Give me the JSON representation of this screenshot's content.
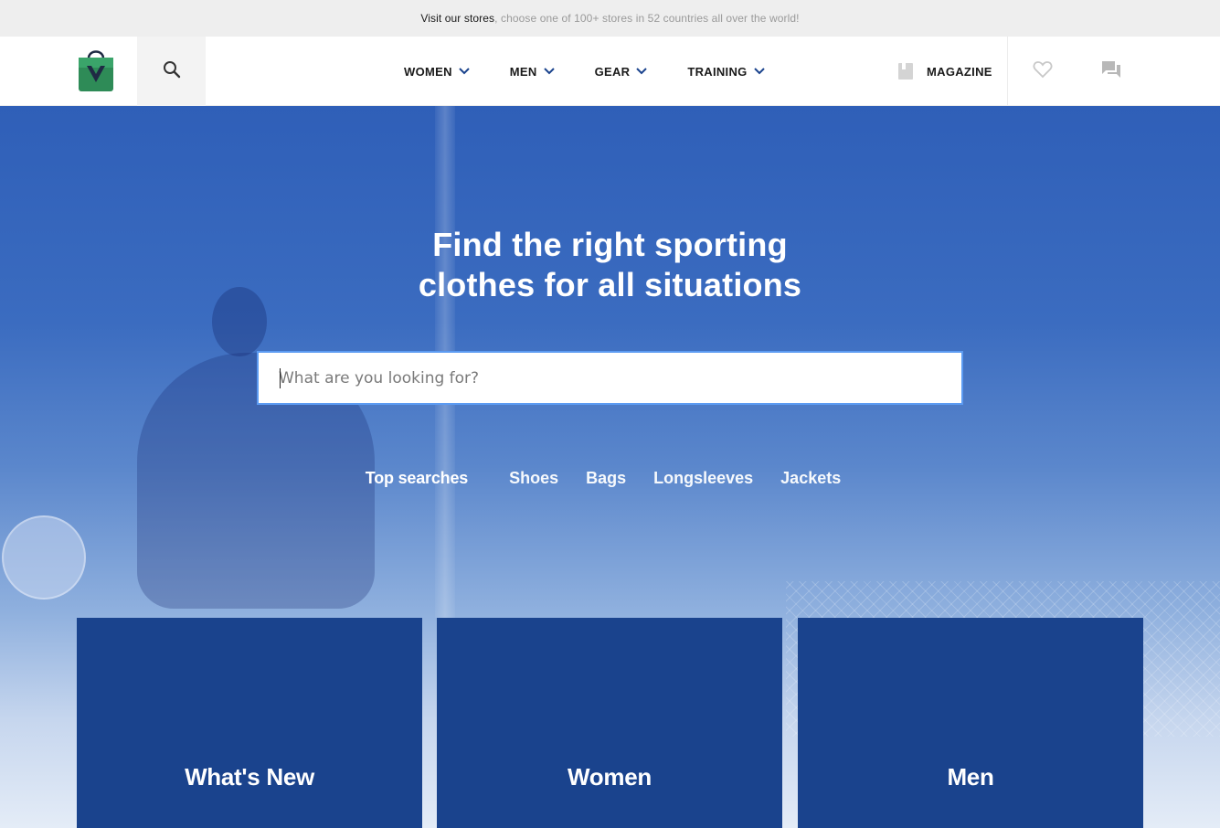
{
  "topbar": {
    "lead": "Visit our stores",
    "rest": ", choose one of 100+ stores in 52 countries all over the world!"
  },
  "header": {
    "logo_icon": "shopping-bag-logo",
    "search_icon": "search-icon",
    "nav": [
      {
        "label": "WOMEN"
      },
      {
        "label": "MEN"
      },
      {
        "label": "GEAR"
      },
      {
        "label": "TRAINING"
      }
    ],
    "magazine_label": "MAGAZINE",
    "wishlist_icon": "heart-icon",
    "chat_icon": "chat-icon"
  },
  "hero": {
    "title_line1": "Find the right sporting",
    "title_line2": "clothes for all situations",
    "search_placeholder": "What are you looking for?",
    "search_value": "",
    "top_searches_label": "Top searches",
    "top_searches": [
      "Shoes",
      "Bags",
      "Longsleeves",
      "Jackets"
    ]
  },
  "categories": [
    {
      "label": "What's New"
    },
    {
      "label": "Women"
    },
    {
      "label": "Men"
    }
  ],
  "colors": {
    "accent_blue": "#1a438d",
    "nav_chevron": "#1a438d",
    "focus_border": "#5c9bf2",
    "logo_green": "#2e8b57"
  }
}
